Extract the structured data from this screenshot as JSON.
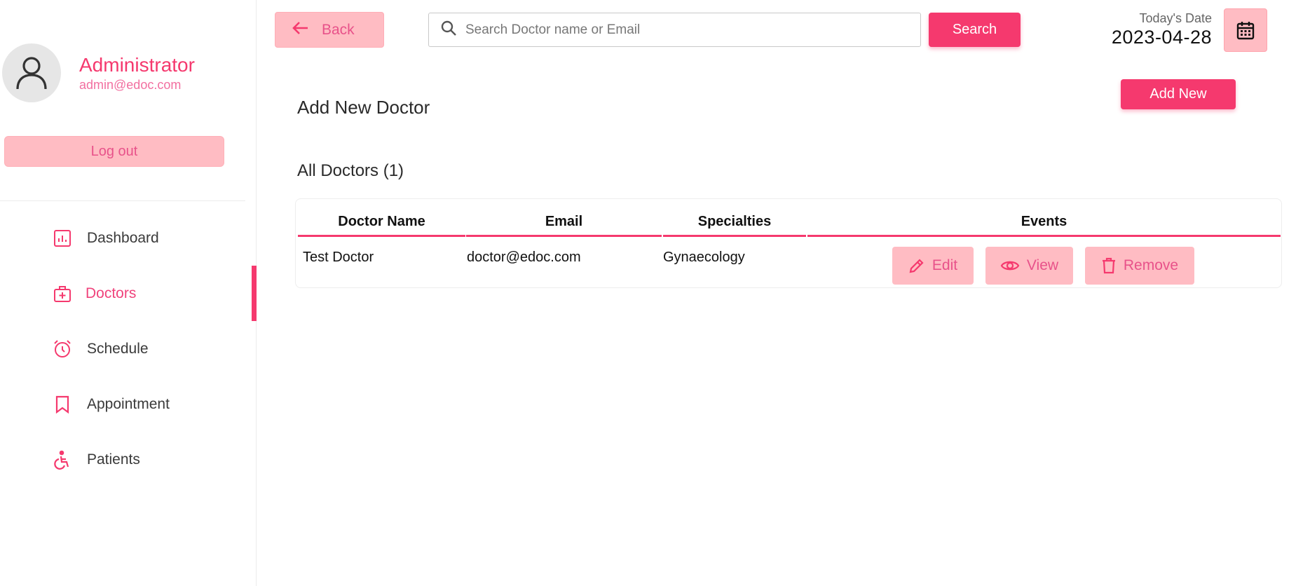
{
  "sidebar": {
    "profile": {
      "name": "Administrator",
      "email": "admin@edoc.com"
    },
    "logout_label": "Log out",
    "items": [
      {
        "label": "Dashboard",
        "icon": "dashboard-icon",
        "active": false
      },
      {
        "label": "Doctors",
        "icon": "doctor-case-icon",
        "active": true
      },
      {
        "label": "Schedule",
        "icon": "alarm-clock-icon",
        "active": false
      },
      {
        "label": "Appointment",
        "icon": "bookmark-icon",
        "active": false
      },
      {
        "label": "Patients",
        "icon": "wheelchair-icon",
        "active": false
      }
    ]
  },
  "header": {
    "back_label": "Back",
    "search": {
      "placeholder": "Search Doctor name or Email",
      "value": ""
    },
    "search_button": "Search",
    "date_label": "Today's Date",
    "date_value": "2023-04-28"
  },
  "main": {
    "add_title": "Add New Doctor",
    "add_button": "Add New",
    "list_title": "All Doctors (1)",
    "table": {
      "columns": [
        "Doctor Name",
        "Email",
        "Specialties",
        "Events"
      ],
      "rows": [
        {
          "name": "Test Doctor",
          "email": "doctor@edoc.com",
          "specialty": "Gynaecology"
        }
      ],
      "actions": {
        "edit": "Edit",
        "view": "View",
        "remove": "Remove"
      }
    }
  },
  "colors": {
    "accent": "#f5396e",
    "accent_light": "#ffbcc3",
    "accent_text": "#e8528a"
  }
}
